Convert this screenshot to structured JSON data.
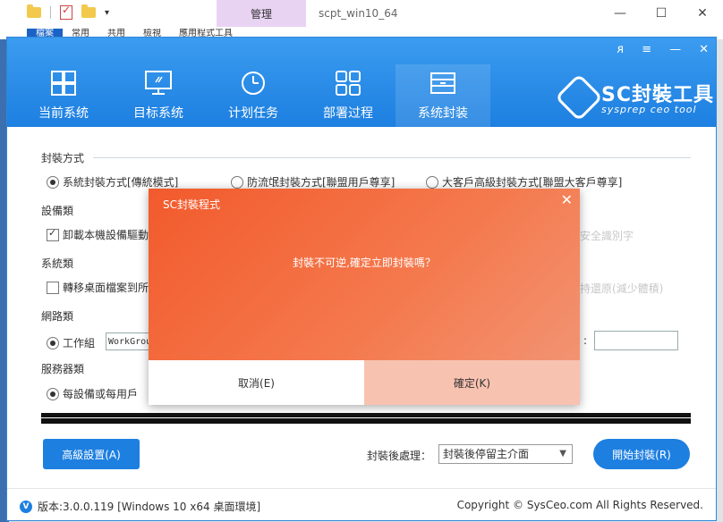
{
  "explorer": {
    "context_tab": "管理",
    "title": "scpt_win10_64",
    "ribbon_tabs": [
      "檔案",
      "常用",
      "共用",
      "檢視",
      "應用程式工具"
    ],
    "controls": {
      "minimize": "—",
      "maximize": "☐",
      "close": "✕"
    }
  },
  "app": {
    "title_controls": {
      "user": "ᴙ",
      "menu": "≡",
      "minimize": "—",
      "close": "✕"
    },
    "nav": [
      {
        "label": "当前系统",
        "icon": "windows-icon"
      },
      {
        "label": "目标系统",
        "icon": "monitor-icon"
      },
      {
        "label": "计划任务",
        "icon": "clock-icon"
      },
      {
        "label": "部署过程",
        "icon": "grid-icon"
      },
      {
        "label": "系统封装",
        "icon": "box-icon"
      }
    ],
    "brand": {
      "name": "SC封裝工具",
      "subtitle": "sysprep ceo tool"
    },
    "sections": {
      "pack_mode": {
        "title": "封裝方式",
        "options": [
          "系統封裝方式[傳統模式]",
          "防流氓封裝方式[聯盟用戶尊享]",
          "大客戶高級封裝方式[聯盟大客戶尊享]"
        ]
      },
      "device": {
        "title": "設備類",
        "checkbox": "卸載本機設備驅動",
        "faded_right": "安全識別字"
      },
      "system": {
        "title": "系統類",
        "checkbox": "轉移桌面檔案到所",
        "faded_right": "持還原(減少體積)"
      },
      "network": {
        "title": "網路類",
        "radio": "工作組",
        "workgroup_value": "WorkGrou",
        "colon": ":"
      },
      "server": {
        "title": "服務器類",
        "radio": "每設備或每用戶"
      }
    },
    "advanced_button": "高級設置(A)",
    "after_label": "封裝後處理：",
    "after_select": "封裝後停留主介面",
    "start_button": "開始封裝(R)",
    "version": "版本:3.0.0.119 [Windows 10 x64 桌面環境]",
    "copyright": "Copyright © SysCeo.com All Rights Reserved."
  },
  "dialog": {
    "title": "SC封裝程式",
    "message": "封裝不可逆,確定立即封裝嗎？",
    "cancel": "取消(E)",
    "ok": "確定(K)",
    "close": "✕"
  }
}
